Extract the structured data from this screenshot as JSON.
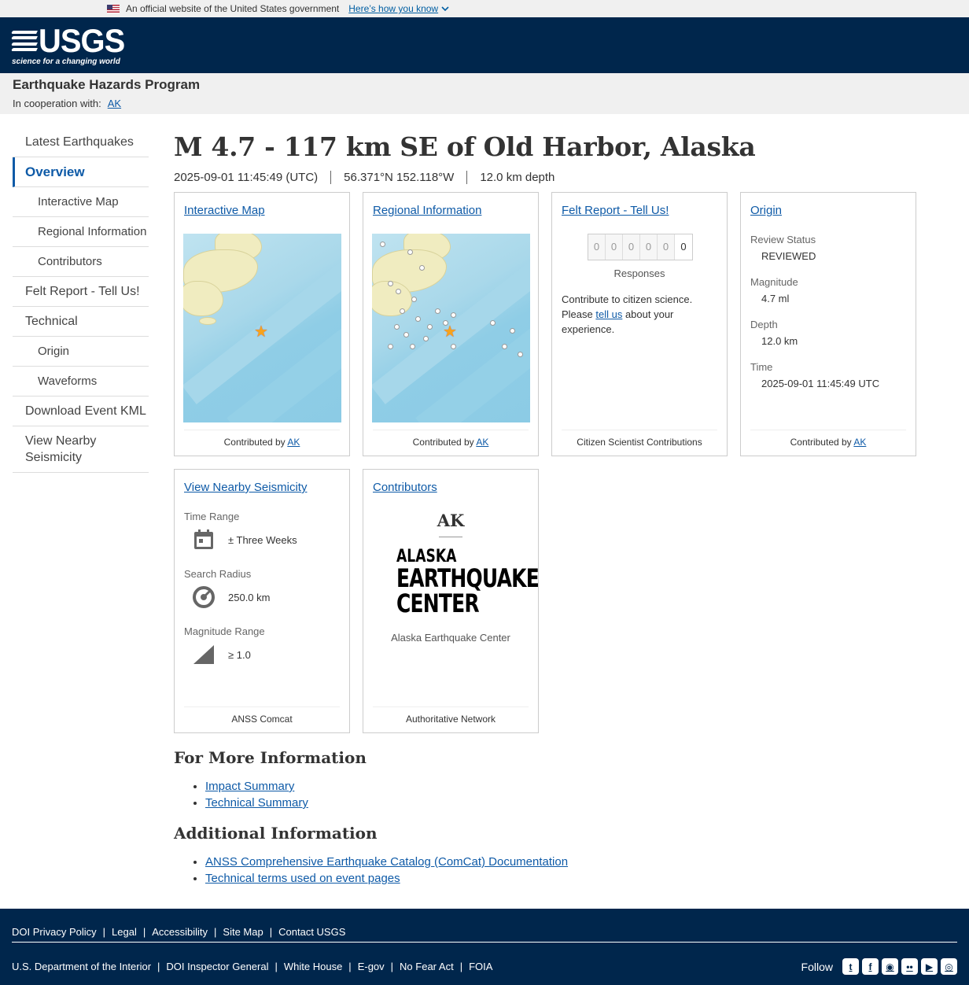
{
  "gov_banner": {
    "text": "An official website of the United States government",
    "link": "Here’s how you know"
  },
  "header": {
    "logo_text": "USGS",
    "logo_tagline": "science for a changing world"
  },
  "site": {
    "name": "Earthquake Hazards Program",
    "coop_label": "In cooperation with:",
    "coop_link": "AK"
  },
  "nav": [
    {
      "label": "Latest Earthquakes"
    },
    {
      "label": "Overview"
    },
    {
      "label": "Interactive Map"
    },
    {
      "label": "Regional Information"
    },
    {
      "label": "Contributors"
    },
    {
      "label": "Felt Report - Tell Us!"
    },
    {
      "label": "Technical"
    },
    {
      "label": "Origin"
    },
    {
      "label": "Waveforms"
    },
    {
      "label": "Download Event KML"
    },
    {
      "label": "View Nearby Seismicity"
    }
  ],
  "event": {
    "title": "M 4.7 - 117 km SE of Old Harbor, Alaska",
    "time": "2025-09-01 11:45:49 (UTC)",
    "location": "56.371°N 152.118°W",
    "depth": "12.0 km depth"
  },
  "cards": {
    "interactive_map": {
      "title": "Interactive Map",
      "foot_prefix": "Contributed by",
      "foot_link": "AK"
    },
    "regional": {
      "title": "Regional Information",
      "foot_prefix": "Contributed by",
      "foot_link": "AK"
    },
    "felt": {
      "title": "Felt Report - Tell Us!",
      "digits": [
        "0",
        "0",
        "0",
        "0",
        "0",
        "0"
      ],
      "responses_label": "Responses",
      "text_before": "Contribute to citizen science. Please ",
      "text_link": "tell us",
      "text_after": " about your experience.",
      "foot": "Citizen Scientist Contributions"
    },
    "origin": {
      "title": "Origin",
      "review_status_label": "Review Status",
      "review_status": "REVIEWED",
      "magnitude_label": "Magnitude",
      "magnitude": "4.7 ml",
      "depth_label": "Depth",
      "depth": "12.0 km",
      "time_label": "Time",
      "time": "2025-09-01 11:45:49 UTC",
      "foot_prefix": "Contributed by",
      "foot_link": "AK"
    },
    "seismicity": {
      "title": "View Nearby Seismicity",
      "time_range_label": "Time Range",
      "time_range": "± Three Weeks",
      "radius_label": "Search Radius",
      "radius": "250.0 km",
      "mag_range_label": "Magnitude Range",
      "mag_range": "≥ 1.0",
      "foot": "ANSS Comcat"
    },
    "contributors": {
      "title": "Contributors",
      "code": "AK",
      "logo_line1": "ALASKA",
      "logo_line2": "EARTHQUAKE",
      "logo_line3": "CENTER",
      "name": "Alaska Earthquake Center",
      "foot": "Authoritative Network"
    }
  },
  "more_info": {
    "heading": "For More Information",
    "links": [
      "Impact Summary",
      "Technical Summary"
    ]
  },
  "additional": {
    "heading": "Additional Information",
    "links": [
      "ANSS Comprehensive Earthquake Catalog (ComCat) Documentation",
      "Technical terms used on event pages"
    ]
  },
  "footer": {
    "row1": [
      "DOI Privacy Policy",
      "Legal",
      "Accessibility",
      "Site Map",
      "Contact USGS"
    ],
    "row2": [
      "U.S. Department of the Interior",
      "DOI Inspector General",
      "White House",
      "E-gov",
      "No Fear Act",
      "FOIA"
    ],
    "follow": "Follow",
    "social_icons": [
      "twitter-icon",
      "facebook-icon",
      "github-icon",
      "flickr-icon",
      "youtube-icon",
      "instagram-icon"
    ]
  },
  "colors": {
    "navy": "#00264c",
    "link": "#0e5aa7",
    "star": "#f7a31c"
  }
}
